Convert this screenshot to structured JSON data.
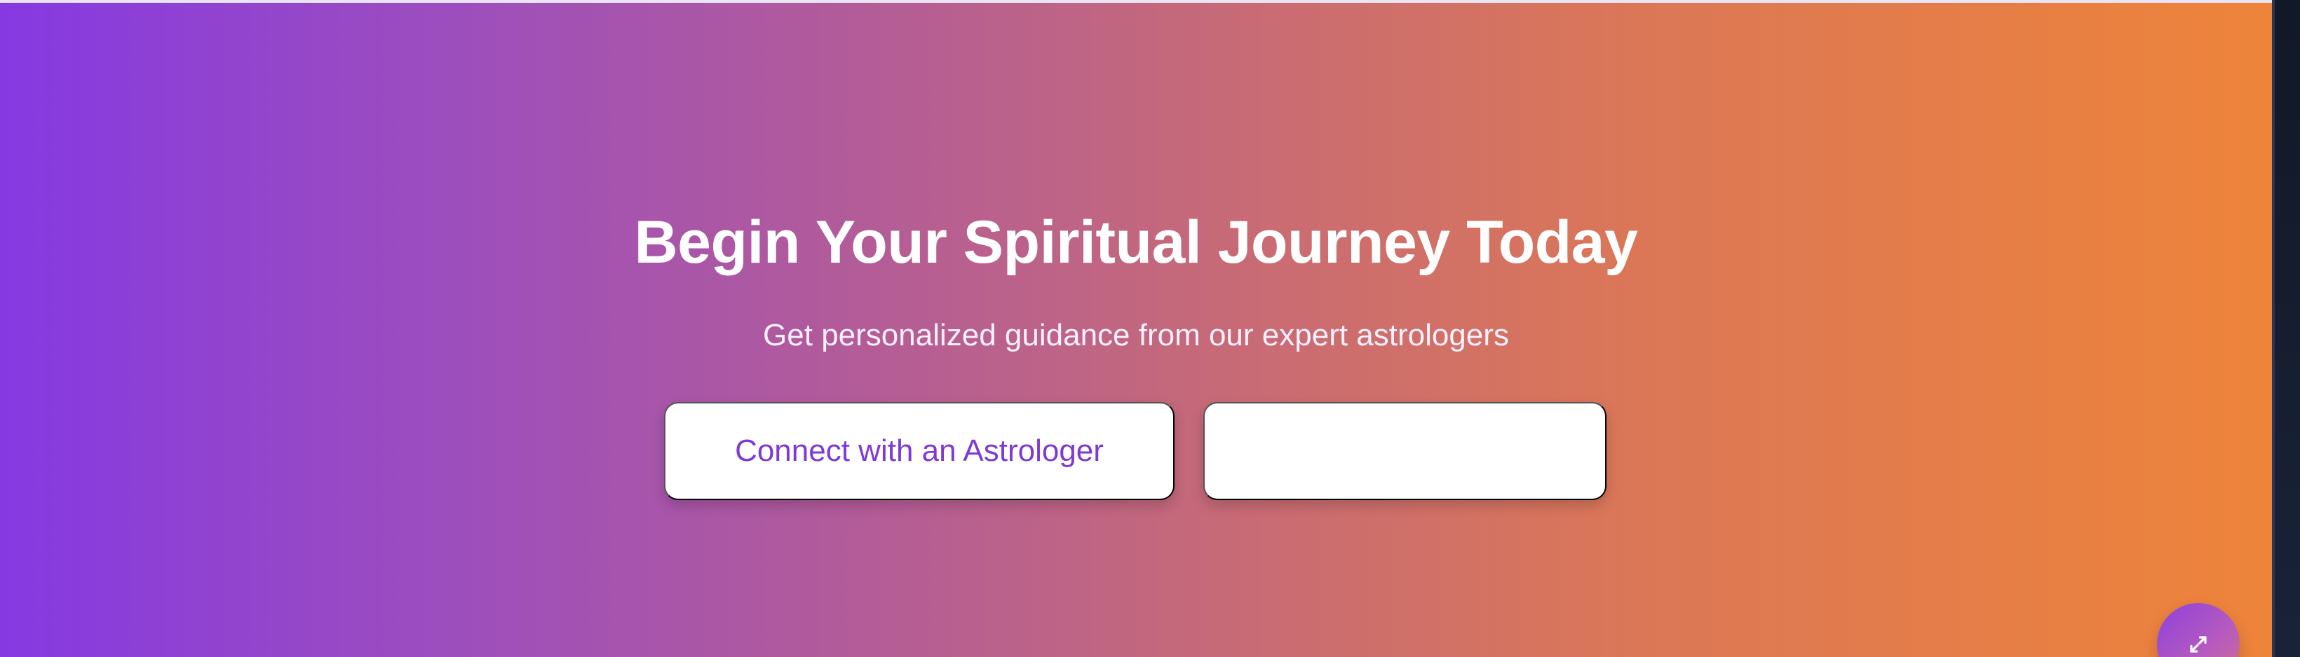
{
  "hero": {
    "headline": "Begin Your Spiritual Journey Today",
    "subtitle": "Get personalized guidance from our expert astrologers",
    "primary_button_label": "Connect with an Astrologer",
    "secondary_button_label": ""
  },
  "icons": {
    "floating_action": "expand-icon"
  },
  "colors": {
    "gradient_start": "#8639e1",
    "gradient_mid": "#c86b75",
    "gradient_end": "#ee843a",
    "accent_text": "#7e39d7",
    "button_background": "#ffffff",
    "page_side": "#111827"
  }
}
